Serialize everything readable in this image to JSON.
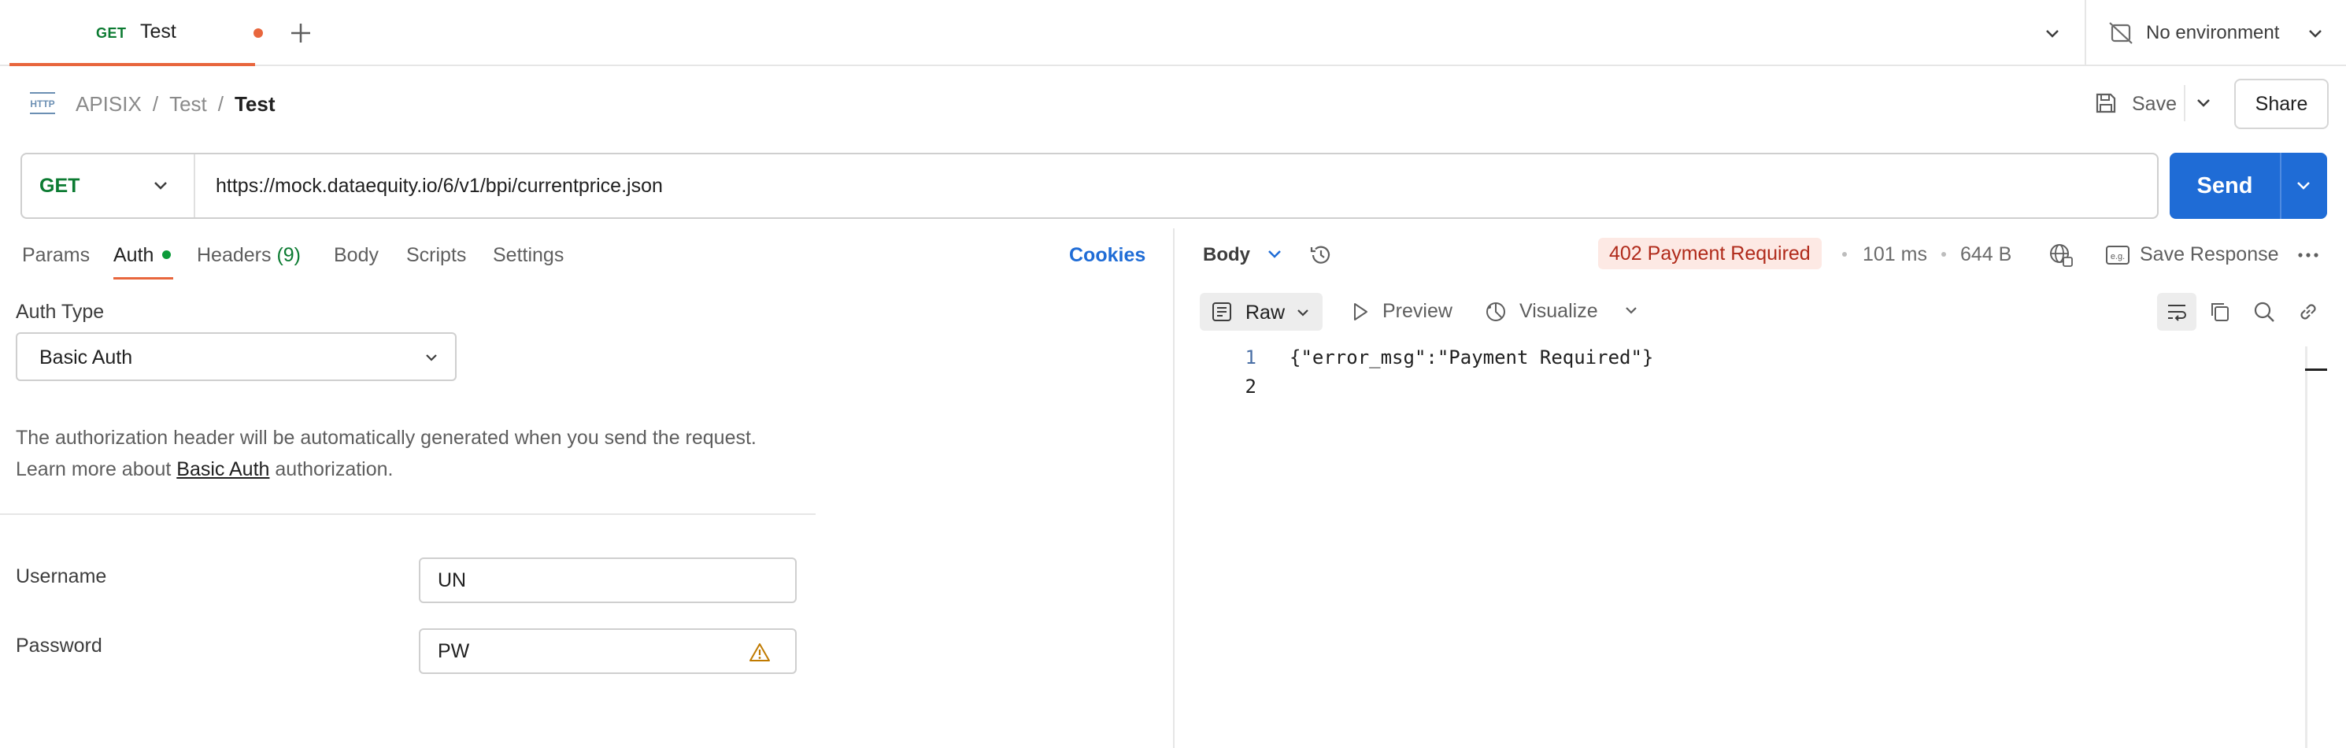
{
  "tab": {
    "method": "GET",
    "name": "Test"
  },
  "environment": {
    "label": "No environment"
  },
  "breadcrumb": {
    "items": [
      "APISIX",
      "Test"
    ],
    "current": "Test",
    "separator": "/"
  },
  "actions": {
    "save_label": "Save",
    "share_label": "Share"
  },
  "request": {
    "method": "GET",
    "url": "https://mock.dataequity.io/6/v1/bpi/currentprice.json",
    "send_label": "Send"
  },
  "request_tabs": {
    "params": "Params",
    "auth": "Auth",
    "headers": "Headers",
    "headers_count": "(9)",
    "body": "Body",
    "scripts": "Scripts",
    "settings": "Settings",
    "cookies": "Cookies",
    "active": "Auth"
  },
  "auth": {
    "type_label": "Auth Type",
    "type_value": "Basic Auth",
    "help_line1": "The authorization header will be automatically generated when you send the request.",
    "help_prefix": "Learn more about ",
    "help_link": "Basic Auth",
    "help_suffix": " authorization.",
    "username_label": "Username",
    "username_value": "UN",
    "password_label": "Password",
    "password_value": "PW"
  },
  "response": {
    "body_label": "Body",
    "status": "402 Payment Required",
    "time": "101 ms",
    "size": "644 B",
    "save_response_label": "Save Response",
    "view_modes": {
      "raw": "Raw",
      "preview": "Preview",
      "visualize": "Visualize"
    },
    "lines": [
      {
        "number": "1",
        "text": "{\"error_msg\":\"Payment Required\"}"
      },
      {
        "number": "2",
        "text": ""
      }
    ]
  },
  "colors": {
    "accent": "#e8663d",
    "method_get": "#0c7b32",
    "send": "#1f6cd6",
    "status_error_bg": "#fde9e4",
    "status_error_text": "#b02a1a"
  },
  "icons": [
    "plus-icon",
    "chevron-down-icon",
    "no-environment-icon",
    "http-icon",
    "save-icon",
    "history-icon",
    "globe-icon",
    "example-icon",
    "more-icon",
    "raw-icon",
    "play-icon",
    "visualize-icon",
    "wrap-icon",
    "copy-icon",
    "search-icon",
    "link-icon",
    "warning-icon"
  ]
}
